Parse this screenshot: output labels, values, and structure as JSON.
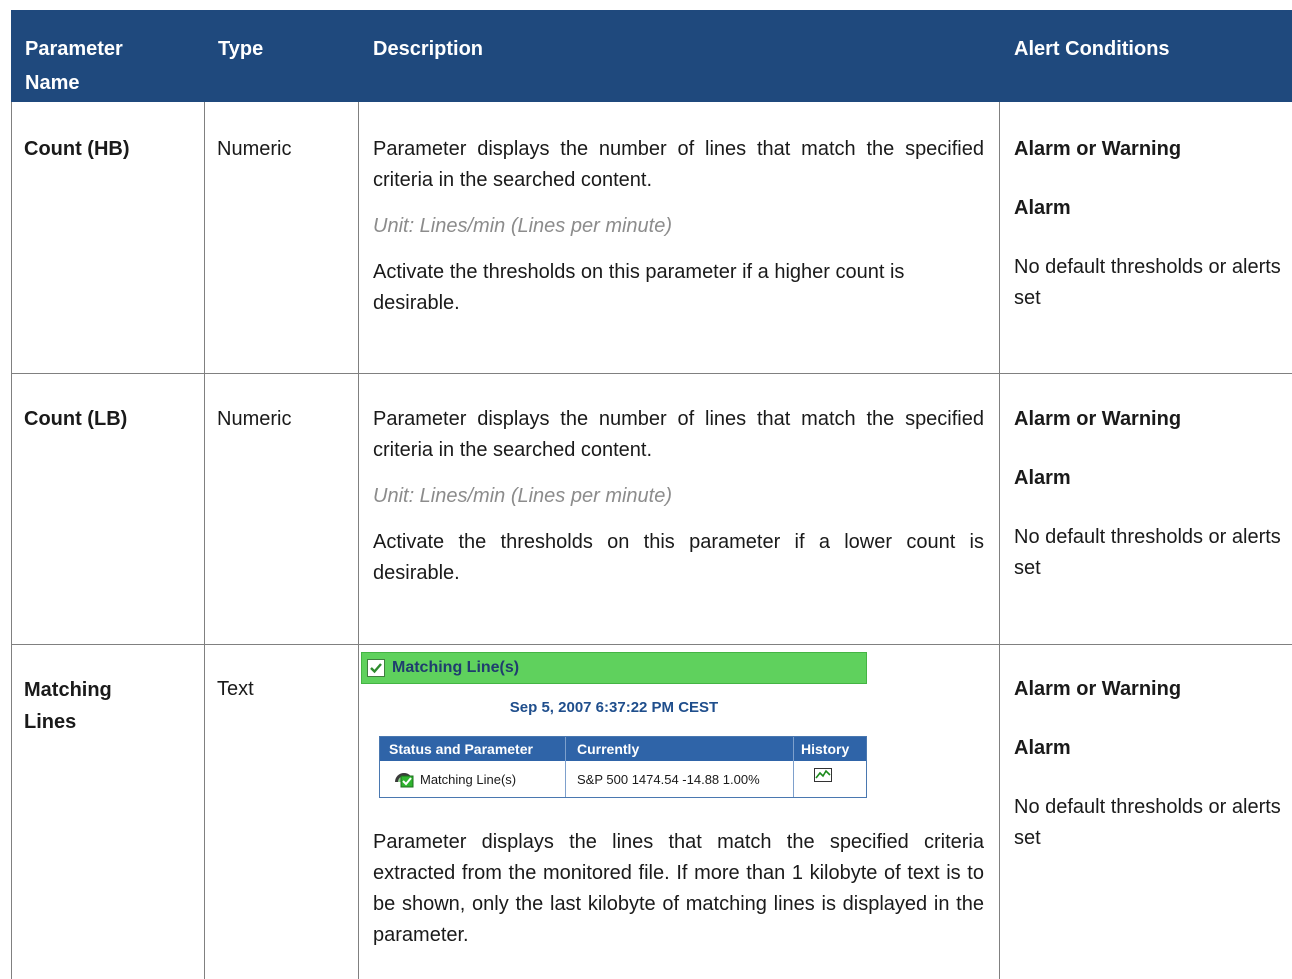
{
  "header": {
    "param_name_line1": "Parameter",
    "param_name_line2": "Name",
    "type": "Type",
    "description": "Description",
    "alert_conditions": "Alert Conditions"
  },
  "rows": [
    {
      "name": "Count (HB)",
      "type": "Numeric",
      "desc1": "Parameter displays the number of lines that match the specified criteria in the searched content.",
      "unit": "Unit: Lines/min (Lines per minute)",
      "desc2": "Activate the thresholds on this parameter if a higher count is desirable.",
      "alert1": "Alarm or Warning",
      "alert2": "Alarm",
      "alert3": "No default thresholds or alerts set"
    },
    {
      "name": "Count (LB)",
      "type": "Numeric",
      "desc1": "Parameter displays the number of lines that match the specified criteria in the searched content.",
      "unit": "Unit: Lines/min (Lines per minute)",
      "desc2": "Activate the thresholds on this parameter if a lower count is desirable.",
      "alert1": "Alarm or Warning",
      "alert2": "Alarm",
      "alert3": "No default thresholds or alerts set"
    },
    {
      "name_line1": "Matching",
      "name_line2": "Lines",
      "type": "Text",
      "desc": "Parameter displays the lines that match the specified criteria extracted from the monitored file. If more than 1 kilobyte of text is to be shown, only the last kilobyte of matching lines is displayed in the parameter.",
      "alert1": "Alarm or Warning",
      "alert2": "Alarm",
      "alert3": "No default thresholds or alerts set"
    }
  ],
  "screenshot": {
    "title": "Matching Line(s)",
    "datetime": "Sep 5, 2007 6:37:22 PM CEST",
    "columns": [
      "Status and Parameter",
      "Currently",
      "History"
    ],
    "row": {
      "parameter": "Matching Line(s)",
      "currently": "S&P 500 1474.54 -14.88 1.00%"
    },
    "icons": [
      "checkbox-icon",
      "status-gauge-icon",
      "history-chart-icon"
    ],
    "colors": {
      "bar": "#5fd15d",
      "table_header": "#2f64a8",
      "date": "#1f4e8c"
    }
  },
  "colors": {
    "header_bg": "#1f497d",
    "header_text": "#ffffff",
    "unit_text": "#8c8c8c",
    "grid": "#808080"
  }
}
